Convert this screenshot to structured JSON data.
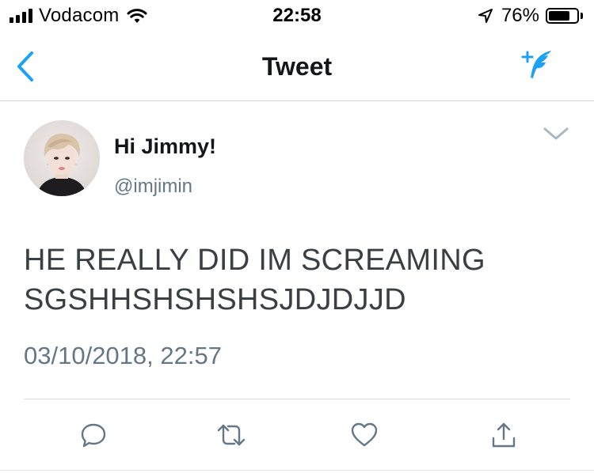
{
  "status_bar": {
    "carrier": "Vodacom",
    "time": "22:58",
    "battery_percent": "76%",
    "battery_level": 0.76,
    "icons": [
      "signal-icon",
      "wifi-icon",
      "location-arrow-icon",
      "battery-icon"
    ]
  },
  "nav": {
    "title": "Tweet",
    "back_icon": "chevron-left-icon",
    "compose_icon": "compose-tweet-icon",
    "accent_color": "#1da1f2"
  },
  "tweet": {
    "display_name": "Hi Jimmy!",
    "handle": "@imjimin",
    "text_lines": [
      "HE REALLY DID IM SCREAMING",
      "SGSHHSHSHSHSJDJDJJD"
    ],
    "timestamp": "03/10/2018, 22:57",
    "more_icon": "chevron-down-icon"
  },
  "actions": [
    {
      "icon": "reply-icon"
    },
    {
      "icon": "retweet-icon"
    },
    {
      "icon": "like-heart-icon"
    },
    {
      "icon": "share-icon"
    }
  ]
}
